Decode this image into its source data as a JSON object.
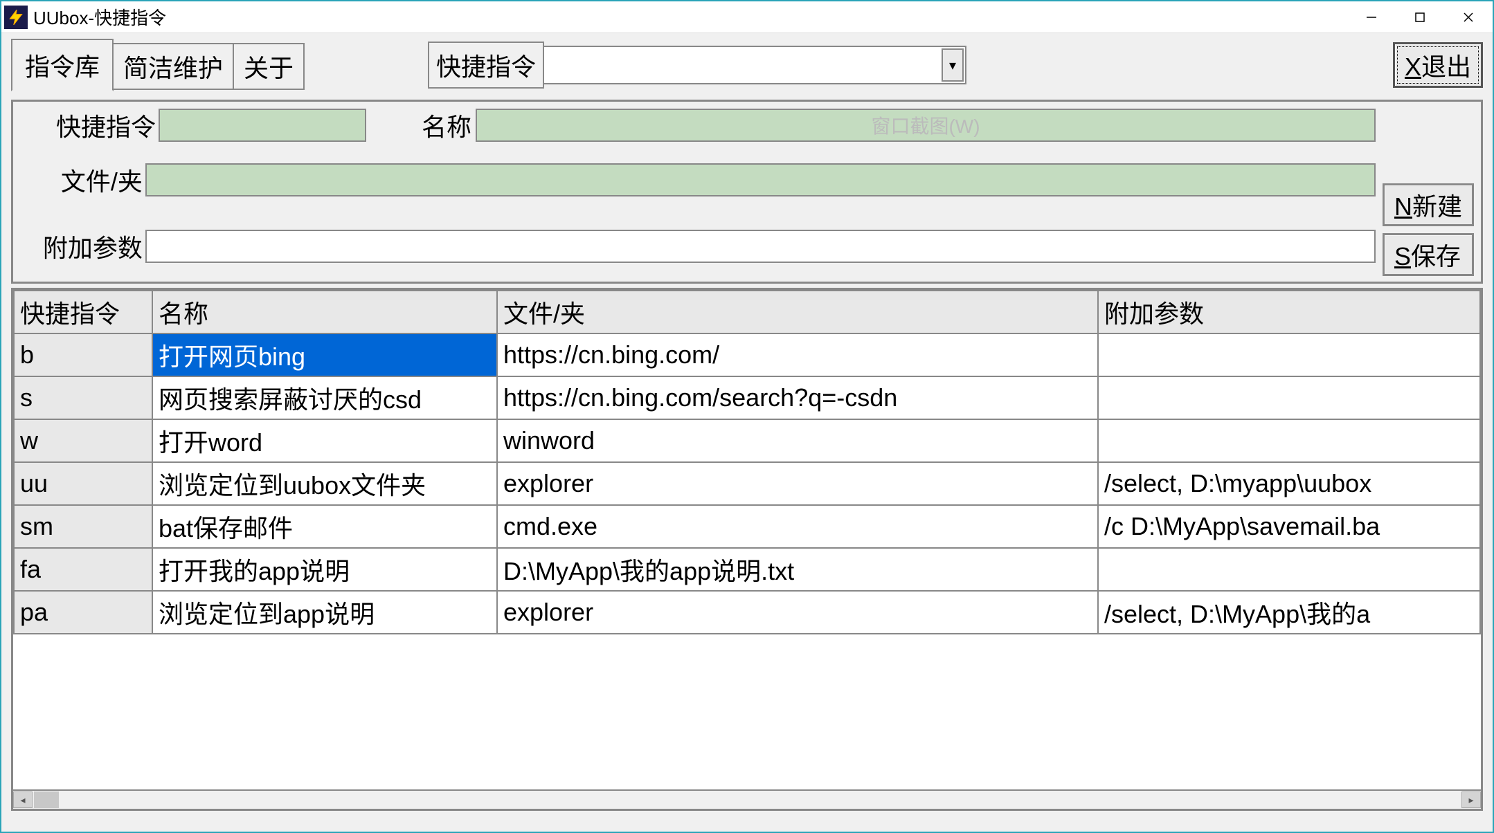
{
  "window": {
    "title": "UUbox-快捷指令"
  },
  "tabs": [
    {
      "label": "指令库",
      "active": true
    },
    {
      "label": "简洁维护",
      "active": false
    },
    {
      "label": "关于",
      "active": false
    }
  ],
  "combo": {
    "label": "快捷指令",
    "value": ""
  },
  "buttons": {
    "exit_prefix": "X",
    "exit_label": "退出",
    "new_prefix": "N",
    "new_label": "新建",
    "save_prefix": "S",
    "save_label": "保存"
  },
  "form": {
    "cmd_label": "快捷指令",
    "cmd_value": "",
    "name_label": "名称",
    "name_value": "",
    "name_watermark": "窗口截图(W)",
    "file_label": "文件/夹",
    "file_value": "",
    "arg_label": "附加参数",
    "arg_value": ""
  },
  "grid": {
    "headers": {
      "cmd": "快捷指令",
      "name": "名称",
      "file": "文件/夹",
      "arg": "附加参数"
    },
    "rows": [
      {
        "cmd": "b",
        "name": "打开网页bing",
        "file": "https://cn.bing.com/",
        "arg": "",
        "selected": true
      },
      {
        "cmd": "s",
        "name": "网页搜索屏蔽讨厌的csd",
        "file": "https://cn.bing.com/search?q=-csdn",
        "arg": ""
      },
      {
        "cmd": "w",
        "name": "打开word",
        "file": "winword",
        "arg": ""
      },
      {
        "cmd": "uu",
        "name": "浏览定位到uubox文件夹",
        "file": "explorer",
        "arg": "/select, D:\\myapp\\uubox"
      },
      {
        "cmd": "sm",
        "name": "bat保存邮件",
        "file": "cmd.exe",
        "arg": "/c D:\\MyApp\\savemail.ba"
      },
      {
        "cmd": "fa",
        "name": "打开我的app说明",
        "file": "D:\\MyApp\\我的app说明.txt",
        "arg": ""
      },
      {
        "cmd": "pa",
        "name": "浏览定位到app说明",
        "file": "explorer",
        "arg": "/select, D:\\MyApp\\我的a"
      }
    ]
  }
}
